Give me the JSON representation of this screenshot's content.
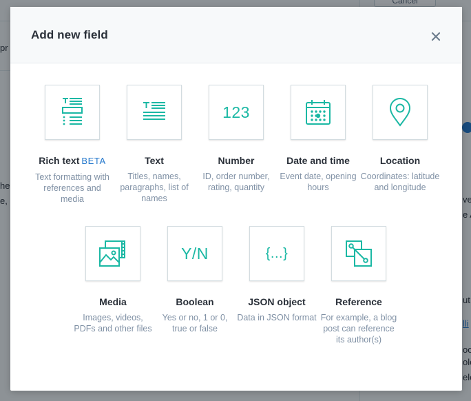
{
  "background": {
    "cancel_label": "Cancel",
    "fragments": [
      "pr",
      "he",
      "e,",
      "ve",
      "e A",
      "ut",
      "lli",
      "oo",
      "ole",
      "ele"
    ]
  },
  "modal": {
    "title": "Add new field",
    "close_icon": "close-icon"
  },
  "fields": [
    {
      "name": "Rich text",
      "badge": "BETA",
      "icon": "rich-text-icon",
      "description": "Text formatting with references and media"
    },
    {
      "name": "Text",
      "badge": "",
      "icon": "text-icon",
      "description": "Titles, names, paragraphs, list of names"
    },
    {
      "name": "Number",
      "badge": "",
      "icon": "number-icon",
      "glyph": "123",
      "description": "ID, order number, rating, quantity"
    },
    {
      "name": "Date and time",
      "badge": "",
      "icon": "calendar-icon",
      "description": "Event date, opening hours"
    },
    {
      "name": "Location",
      "badge": "",
      "icon": "location-pin-icon",
      "description": "Coordinates: latitude and longitude"
    },
    {
      "name": "Media",
      "badge": "",
      "icon": "media-icon",
      "description": "Images, videos, PDFs and other files"
    },
    {
      "name": "Boolean",
      "badge": "",
      "icon": "boolean-icon",
      "glyph": "Y/N",
      "description": "Yes or no, 1 or 0, true or false"
    },
    {
      "name": "JSON object",
      "badge": "",
      "icon": "json-icon",
      "glyph": "{...}",
      "description": "Data in JSON format"
    },
    {
      "name": "Reference",
      "badge": "",
      "icon": "reference-icon",
      "description": "For example, a blog post can reference its author(s)"
    }
  ],
  "colors": {
    "accent": "#1bb8a4",
    "beta": "#2478cc",
    "muted_text": "#8091a5"
  }
}
